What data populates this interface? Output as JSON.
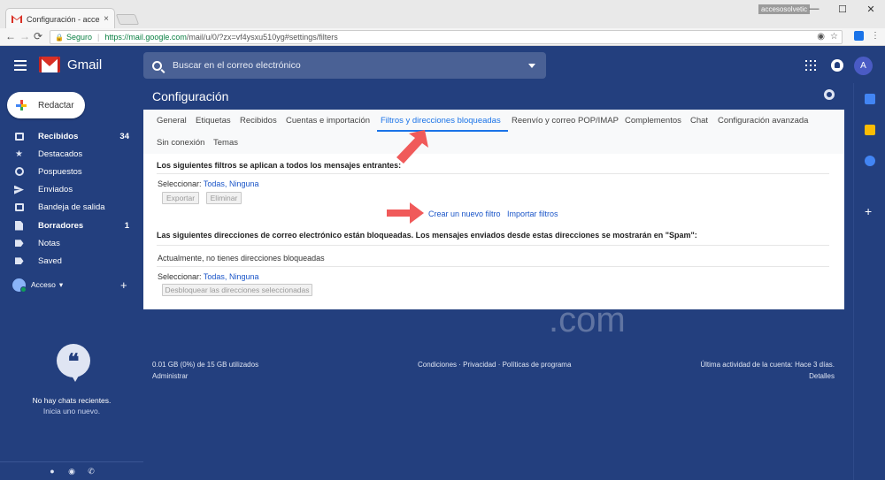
{
  "browser": {
    "tab_title": "Configuración - accesos",
    "tab_close": "×",
    "overlay_label": "accesosolvetic",
    "window_buttons": [
      "—",
      "☐",
      "✕"
    ],
    "nav": {
      "back": "←",
      "forward": "→",
      "reload": "⟳"
    },
    "secure_label": "Seguro",
    "url_host": "https://mail.google.com",
    "url_rest": "/mail/u/0/?zx=vf4ysxu510yg#settings/filters",
    "url_right_icons": [
      "◉",
      "☆"
    ],
    "menu": "⋮"
  },
  "header": {
    "app_name": "Gmail",
    "search_placeholder": "Buscar en el correo electrónico",
    "avatar_letter": "A"
  },
  "sidebar": {
    "compose_label": "Redactar",
    "items": [
      {
        "label": "Recibidos",
        "count": "34",
        "bold": true,
        "icon": "inbox-icon"
      },
      {
        "label": "Destacados",
        "count": "",
        "bold": false,
        "icon": "star-icon"
      },
      {
        "label": "Pospuestos",
        "count": "",
        "bold": false,
        "icon": "clock-icon"
      },
      {
        "label": "Enviados",
        "count": "",
        "bold": false,
        "icon": "send-icon"
      },
      {
        "label": "Bandeja de salida",
        "count": "",
        "bold": false,
        "icon": "outbox-icon"
      },
      {
        "label": "Borradores",
        "count": "1",
        "bold": true,
        "icon": "draft-icon"
      },
      {
        "label": "Notas",
        "count": "",
        "bold": false,
        "icon": "label-icon"
      },
      {
        "label": "Saved",
        "count": "",
        "bold": false,
        "icon": "label-icon"
      }
    ],
    "hangouts_user": "Acceso",
    "hangouts_caret": "▾",
    "hangouts_add": "+",
    "quote_glyph": "❝",
    "no_chats_line1": "No hay chats recientes.",
    "no_chats_line2": "Inicia uno nuevo."
  },
  "main": {
    "page_title": "Configuración",
    "tabs": [
      {
        "label": "General",
        "active": false
      },
      {
        "label": "Etiquetas",
        "active": false
      },
      {
        "label": "Recibidos",
        "active": false
      },
      {
        "label": "Cuentas e importación",
        "active": false
      },
      {
        "label": "Filtros y direcciones bloqueadas",
        "active": true
      },
      {
        "label": "Reenvío y correo POP/IMAP",
        "active": false
      },
      {
        "label": "Complementos",
        "active": false
      },
      {
        "label": "Chat",
        "active": false
      },
      {
        "label": "Configuración avanzada",
        "active": false
      },
      {
        "label": "Sin conexión",
        "active": false
      },
      {
        "label": "Temas",
        "active": false
      }
    ],
    "filters_heading": "Los siguientes filtros se aplican a todos los mensajes entrantes:",
    "select_label": "Seleccionar:",
    "select_all": "Todas",
    "select_sep": ",",
    "select_none": "Ninguna",
    "export_button": "Exportar",
    "delete_button": "Eliminar",
    "create_filter": "Crear un nuevo filtro",
    "import_filters": "Importar filtros",
    "blocked_heading": "Las siguientes direcciones de correo electrónico están bloqueadas. Los mensajes enviados desde estas direcciones se mostrarán en \"Spam\":",
    "no_blocked": "Actualmente, no tienes direcciones bloqueadas",
    "unblock_button": "Desbloquear las direcciones seleccionadas"
  },
  "watermark": {
    "main": "olvetic",
    "com": ".com"
  },
  "footer": {
    "storage": "0.01 GB (0%) de 15 GB utilizados",
    "manage": "Administrar",
    "legal": "Condiciones · Privacidad · Políticas de programa",
    "last_activity": "Última actividad de la cuenta: Hace 3 días.",
    "details": "Detalles"
  },
  "right_panel": {
    "add": "+"
  },
  "colors": {
    "background": "#233f7e",
    "accent": "#1a73e8",
    "arrow": "#f05a5a"
  }
}
